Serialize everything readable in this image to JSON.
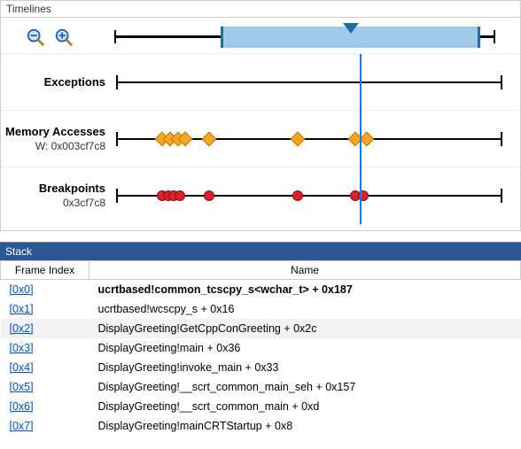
{
  "panels": {
    "timelines_title": "Timelines",
    "stack_title": "Stack"
  },
  "zoom": {
    "zoom_out_label": "Zoom Out",
    "zoom_in_label": "Zoom In"
  },
  "overview": {
    "selection_start_pct": 28,
    "selection_end_pct": 96,
    "playhead_pct": 62,
    "ticks_pct": [
      0,
      100
    ]
  },
  "tracks": [
    {
      "id": "exceptions",
      "title": "Exceptions",
      "sub": "",
      "marker_shape": "none",
      "markers_pct": []
    },
    {
      "id": "memory",
      "title": "Memory Accesses",
      "sub": "W: 0x003cf7c8",
      "marker_shape": "diamond",
      "markers_pct": [
        12,
        14,
        16,
        18,
        24,
        47,
        62,
        65
      ]
    },
    {
      "id": "breakpoints",
      "title": "Breakpoints",
      "sub": "0x3cf7c8",
      "marker_shape": "circle",
      "markers_pct": [
        12,
        13.5,
        15,
        16.5,
        24,
        47,
        62,
        64
      ]
    }
  ],
  "playhead_pct": 63,
  "stack": {
    "columns": {
      "frame": "Frame Index",
      "name": "Name"
    },
    "rows": [
      {
        "frame": "[0x0]",
        "name": "ucrtbased!common_tcscpy_s<wchar_t> + 0x187",
        "bold": true
      },
      {
        "frame": "[0x1]",
        "name": "ucrtbased!wcscpy_s + 0x16"
      },
      {
        "frame": "[0x2]",
        "name": "DisplayGreeting!GetCppConGreeting + 0x2c",
        "alt": true
      },
      {
        "frame": "[0x3]",
        "name": "DisplayGreeting!main + 0x36"
      },
      {
        "frame": "[0x4]",
        "name": "DisplayGreeting!invoke_main + 0x33"
      },
      {
        "frame": "[0x5]",
        "name": "DisplayGreeting!__scrt_common_main_seh + 0x157"
      },
      {
        "frame": "[0x6]",
        "name": "DisplayGreeting!__scrt_common_main + 0xd"
      },
      {
        "frame": "[0x7]",
        "name": "DisplayGreeting!mainCRTStartup + 0x8"
      }
    ]
  }
}
